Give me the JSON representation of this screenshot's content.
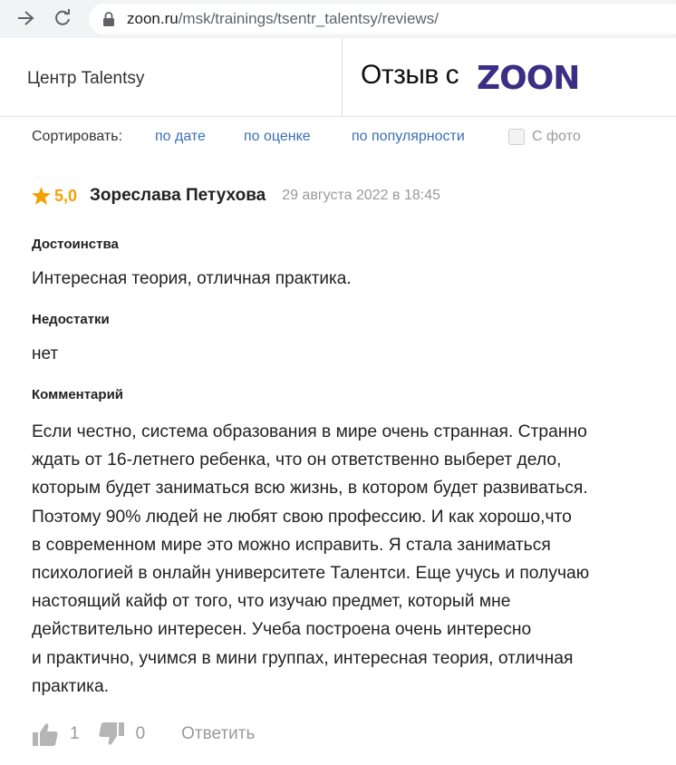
{
  "browser": {
    "url_domain": "zoon.ru",
    "url_path": "/msk/trainings/tsentr_talentsy/reviews/"
  },
  "header": {
    "org_name": "Центр Talentsy",
    "source_label": "Отзыв с",
    "logo_text": "ZOON",
    "logo_color": "#3b2e84"
  },
  "sort": {
    "label": "Сортировать:",
    "options": [
      "по дате",
      "по оценке",
      "по популярности"
    ],
    "photo_filter_label": "С фото",
    "photo_filter_checked": false,
    "link_color": "#3a6fb6"
  },
  "review": {
    "rating": "5,0",
    "author": "Зореслава Петухова",
    "date": "29 августа 2022 в 18:45",
    "pros_title": "Достоинства",
    "pros_text": "Интересная теория, отличная практика.",
    "cons_title": "Недостатки",
    "cons_text": "нет",
    "comment_title": "Комментарий",
    "comment_text": "Если честно, система образования в мире очень странная. Странно\nждать от 16-летнего ребенка, что он ответственно выберет дело,\nкоторым будет заниматься всю жизнь, в котором будет развиваться.\nПоэтому 90% людей не любят свою профессию. И как хорошо,что\nв современном мире это можно исправить. Я стала заниматься\nпсихологией в онлайн университете Талентси. Еще учусь и получаю\nнастоящий кайф от того, что изучаю предмет, который мне\nдействительно интересен. Учеба построена очень интересно\nи практично, учимся в мини группах, интересная теория, отличная\nпрактика.",
    "likes": "1",
    "dislikes": "0",
    "reply_label": "Ответить",
    "star_color": "#f4a100"
  },
  "icons": {
    "back": "arrow-left-icon",
    "reload": "reload-icon",
    "lock": "lock-icon",
    "star": "star-icon",
    "like": "thumbs-up-icon",
    "dislike": "thumbs-down-icon"
  }
}
